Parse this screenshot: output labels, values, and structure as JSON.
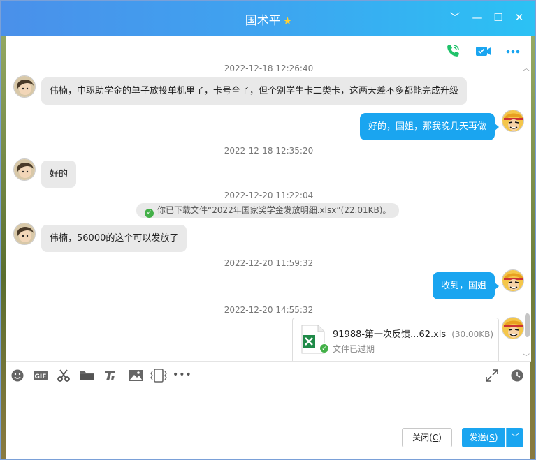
{
  "window": {
    "title": "国术平",
    "title_icon": "star-icon",
    "controls": {
      "dropdown": "﹀",
      "minimize": "—",
      "maximize": "☐",
      "close": "✕"
    }
  },
  "chat_tools": {
    "call": "phone-icon",
    "video": "video-icon",
    "more": "more-icon"
  },
  "messages": [
    {
      "type": "timestamp",
      "text": "2022-12-18 12:26:40"
    },
    {
      "type": "incoming",
      "text": "伟楠，中职助学金的单子放投单机里了，卡号全了，但个别学生卡二类卡，这两天差不多都能完成升级"
    },
    {
      "type": "outgoing",
      "text": "好的，国姐，那我晚几天再做"
    },
    {
      "type": "timestamp",
      "text": "2022-12-18 12:35:20"
    },
    {
      "type": "incoming",
      "text": "好的"
    },
    {
      "type": "timestamp",
      "text": "2022-12-20 11:22:04"
    },
    {
      "type": "notice",
      "text": "你已下载文件“2022年国家奖学金发放明细.xlsx”(22.01KB)。"
    },
    {
      "type": "incoming",
      "text": "伟楠，56000的这个可以发放了"
    },
    {
      "type": "timestamp",
      "text": "2022-12-20 11:59:32"
    },
    {
      "type": "outgoing",
      "text": "收到，国姐"
    },
    {
      "type": "timestamp",
      "text": "2022-12-20 14:55:32"
    },
    {
      "type": "file",
      "name": "91988-第一次反馈...62.xls",
      "size": "(30.00KB)",
      "status": "文件已过期"
    }
  ],
  "input_toolbar": {
    "emoji": "emoji-icon",
    "gif": "GIF",
    "screenshot": "scissors-icon",
    "folder": "folder-icon",
    "rich_text": "rich-text-icon",
    "image": "image-icon",
    "shake": "shake-icon",
    "more": "•••",
    "expand": "expand-icon",
    "history": "clock-icon"
  },
  "input": {
    "value": "",
    "placeholder": ""
  },
  "buttons": {
    "close_label": "关闭",
    "close_key": "C",
    "send_label": "发送",
    "send_key": "S",
    "send_dropdown": "﹀"
  },
  "colors": {
    "titlebar_start": "#4a90ea",
    "titlebar_end": "#2bc2f4",
    "outgoing_bubble": "#1aa5f0",
    "incoming_bubble": "#e9e9e9",
    "phone_icon": "#20c26a",
    "video_icon": "#1aa5f0"
  }
}
